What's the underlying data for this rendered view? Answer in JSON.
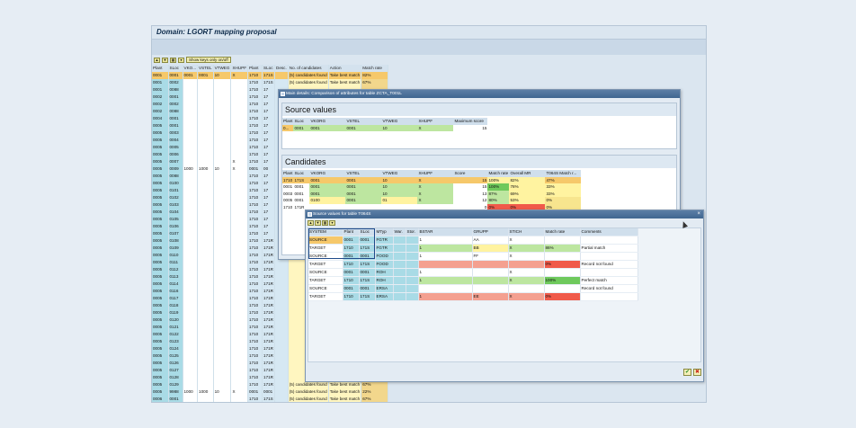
{
  "window_title": "Domain: LGORT mapping proposal",
  "toolbar": {
    "icon1": "filter-icon",
    "icon2": "sort-icon",
    "show_keys_label": "Show keys only on/off"
  },
  "grid": {
    "headers": [
      "Plant",
      "SLoc",
      "VKO...",
      "VSTEL",
      "VTWEG",
      "XHUPF",
      "Plant",
      "SLoc",
      "Desc.",
      "No. of candidates",
      "Action",
      "Match rate"
    ],
    "rows": [
      {
        "plant": "0001",
        "sloc": "0001",
        "vko": "0001",
        "vstel": "0001",
        "vtweg": "10",
        "xhupf": "X",
        "tplant": "1710",
        "tsloc": "171S",
        "cand": "(5) candidates found",
        "action": "Take best match",
        "rate": "82%"
      },
      {
        "plant": "0001",
        "sloc": "0002",
        "tplant": "1710",
        "tsloc": "171S",
        "cand": "(5) candidates found",
        "action": "Take best match",
        "rate": "67%"
      },
      {
        "plant": "0001",
        "sloc": "0088",
        "tplant": "1710",
        "tsloc": "17"
      },
      {
        "plant": "0002",
        "sloc": "0001",
        "tplant": "1710",
        "tsloc": "17"
      },
      {
        "plant": "0002",
        "sloc": "0002",
        "tplant": "1710",
        "tsloc": "17"
      },
      {
        "plant": "0002",
        "sloc": "0088",
        "tplant": "1710",
        "tsloc": "17"
      },
      {
        "plant": "0004",
        "sloc": "0001",
        "tplant": "1710",
        "tsloc": "17"
      },
      {
        "plant": "0005",
        "sloc": "0001",
        "tplant": "1710",
        "tsloc": "17"
      },
      {
        "plant": "0005",
        "sloc": "0003",
        "tplant": "1710",
        "tsloc": "17"
      },
      {
        "plant": "0005",
        "sloc": "0004",
        "tplant": "1710",
        "tsloc": "17"
      },
      {
        "plant": "0005",
        "sloc": "0005",
        "tplant": "1710",
        "tsloc": "17"
      },
      {
        "plant": "0005",
        "sloc": "0006",
        "tplant": "1710",
        "tsloc": "17"
      },
      {
        "plant": "0005",
        "sloc": "0007",
        "xhupf": "X",
        "tplant": "1710",
        "tsloc": "17"
      },
      {
        "plant": "0005",
        "sloc": "0009",
        "vko": "1000",
        "vstel": "1000",
        "vtweg": "10",
        "xhupf": "X",
        "tplant": "0001",
        "tsloc": "00"
      },
      {
        "plant": "0005",
        "sloc": "0088",
        "tplant": "1710",
        "tsloc": "17"
      },
      {
        "plant": "0005",
        "sloc": "0100",
        "tplant": "1710",
        "tsloc": "17"
      },
      {
        "plant": "0005",
        "sloc": "0101",
        "tplant": "1710",
        "tsloc": "17"
      },
      {
        "plant": "0005",
        "sloc": "0102",
        "tplant": "1710",
        "tsloc": "17"
      },
      {
        "plant": "0005",
        "sloc": "0103",
        "tplant": "1710",
        "tsloc": "17"
      },
      {
        "plant": "0005",
        "sloc": "0104",
        "tplant": "1710",
        "tsloc": "17"
      },
      {
        "plant": "0005",
        "sloc": "0105",
        "tplant": "1710",
        "tsloc": "17"
      },
      {
        "plant": "0005",
        "sloc": "0106",
        "tplant": "1710",
        "tsloc": "17"
      },
      {
        "plant": "0005",
        "sloc": "0107",
        "tplant": "1710",
        "tsloc": "17"
      },
      {
        "plant": "0005",
        "sloc": "0108",
        "tplant": "1710",
        "tsloc": "171R"
      },
      {
        "plant": "0005",
        "sloc": "0109",
        "tplant": "1710",
        "tsloc": "171R"
      },
      {
        "plant": "0005",
        "sloc": "0110",
        "tplant": "1710",
        "tsloc": "171R"
      },
      {
        "plant": "0005",
        "sloc": "0111",
        "tplant": "1710",
        "tsloc": "171R"
      },
      {
        "plant": "0005",
        "sloc": "0112",
        "tplant": "1710",
        "tsloc": "171R"
      },
      {
        "plant": "0005",
        "sloc": "0113",
        "tplant": "1710",
        "tsloc": "171R"
      },
      {
        "plant": "0005",
        "sloc": "0114",
        "tplant": "1710",
        "tsloc": "171R"
      },
      {
        "plant": "0005",
        "sloc": "0116",
        "tplant": "1710",
        "tsloc": "171R"
      },
      {
        "plant": "0005",
        "sloc": "0117",
        "tplant": "1710",
        "tsloc": "171R"
      },
      {
        "plant": "0005",
        "sloc": "0118",
        "tplant": "1710",
        "tsloc": "171R"
      },
      {
        "plant": "0005",
        "sloc": "0119",
        "tplant": "1710",
        "tsloc": "171R"
      },
      {
        "plant": "0005",
        "sloc": "0120",
        "tplant": "1710",
        "tsloc": "171R"
      },
      {
        "plant": "0005",
        "sloc": "0121",
        "tplant": "1710",
        "tsloc": "171R"
      },
      {
        "plant": "0005",
        "sloc": "0122",
        "tplant": "1710",
        "tsloc": "171R"
      },
      {
        "plant": "0005",
        "sloc": "0123",
        "tplant": "1710",
        "tsloc": "171R"
      },
      {
        "plant": "0005",
        "sloc": "0124",
        "tplant": "1710",
        "tsloc": "171R"
      },
      {
        "plant": "0005",
        "sloc": "0125",
        "tplant": "1710",
        "tsloc": "171R"
      },
      {
        "plant": "0005",
        "sloc": "0126",
        "tplant": "1710",
        "tsloc": "171R"
      },
      {
        "plant": "0005",
        "sloc": "0127",
        "tplant": "1710",
        "tsloc": "171R"
      },
      {
        "plant": "0005",
        "sloc": "0128",
        "tplant": "1710",
        "tsloc": "171R"
      },
      {
        "plant": "0005",
        "sloc": "0129",
        "tplant": "1710",
        "tsloc": "171R",
        "cand": "(5) candidates found",
        "action": "Take best match",
        "rate": "67%"
      },
      {
        "plant": "0005",
        "sloc": "9988",
        "vko": "1000",
        "vstel": "1000",
        "vtweg": "10",
        "xhupf": "X",
        "tplant": "0001",
        "tsloc": "0001",
        "cand": "(5) candidates found",
        "action": "Take best match",
        "rate": "22%"
      },
      {
        "plant": "0006",
        "sloc": "0001",
        "tplant": "1710",
        "tsloc": "171S",
        "cand": "(5) candidates found",
        "action": "Take best match",
        "rate": "67%"
      }
    ]
  },
  "main_details": {
    "title": "Main details: Comparison of attributes for table ZCTA_T001L",
    "source_values_title": "Source values",
    "source_headers": [
      "Plant",
      "SLoc",
      "VKORG",
      "VSTEL",
      "VTWEG",
      "XHUPF",
      "Maximum score"
    ],
    "source_row": [
      "0...",
      "0001",
      "0001",
      "0001",
      "10",
      "X",
      "15"
    ],
    "candidates_title": "Candidates",
    "cand_headers": [
      "Plant",
      "SLoc",
      "VKORG",
      "VSTEL",
      "VTWEG",
      "XHUPF",
      "Score",
      "Match rate",
      "Overall MR",
      "T064S Match r..."
    ],
    "cand_rows": [
      {
        "plant": "1710",
        "sloc": "171S",
        "vkorg": "0001",
        "vstel": "0001",
        "vtweg": "10",
        "xhupf": "X",
        "score": "15",
        "mr": "100%",
        "omr": "82%",
        "t064": "47%"
      },
      {
        "plant": "0001",
        "sloc": "0001",
        "vkorg": "0001",
        "vstel": "0001",
        "vtweg": "10",
        "xhupf": "X",
        "score": "15",
        "mr": "100%",
        "omr": "78%",
        "t064": "33%"
      },
      {
        "plant": "0003",
        "sloc": "0001",
        "vkorg": "0001",
        "vstel": "0001",
        "vtweg": "10",
        "xhupf": "X",
        "score": "13",
        "mr": "87%",
        "omr": "69%",
        "t064": "33%"
      },
      {
        "plant": "0005",
        "sloc": "0001",
        "vkorg": "0100",
        "vstel": "0001",
        "vtweg": "01",
        "xhupf": "X",
        "score": "12",
        "mr": "80%",
        "omr": "53%",
        "t064": "0%"
      },
      {
        "plant": "1710",
        "sloc": "171R",
        "vkorg": "",
        "vstel": "",
        "vtweg": "",
        "xhupf": "",
        "score": "0",
        "mr": "0%",
        "omr": "0%",
        "t064": "0%"
      }
    ]
  },
  "source_values_dialog": {
    "title": "Source values for table T064S",
    "headers": [
      "SYSTEM",
      "Plant",
      "SLoc",
      "MTyp",
      "War.",
      "Stor.",
      "BSTAR",
      "GRUPP",
      "STICH",
      "Match rate",
      "Comments"
    ],
    "rows": [
      {
        "system": "SOURCE",
        "plant": "0001",
        "sloc": "0001",
        "mtyp": "FGTR",
        "bstar": "1",
        "grupp": "AA",
        "stich": "X",
        "rate": "",
        "comment": ""
      },
      {
        "system": "TARGET",
        "plant": "1710",
        "sloc": "171S",
        "mtyp": "FGTR",
        "bstar": "1",
        "grupp": "BB",
        "stich": "X",
        "rate": "86%",
        "comment": "Partial match"
      },
      {
        "system": "SOURCE",
        "plant": "0001",
        "sloc": "0001",
        "mtyp": "FOOD",
        "bstar": "1",
        "grupp": "FF",
        "stich": "X",
        "rate": "",
        "comment": ""
      },
      {
        "system": "TARGET",
        "plant": "1710",
        "sloc": "171S",
        "mtyp": "FOOD",
        "bstar": "",
        "grupp": "",
        "stich": "",
        "rate": "0%",
        "comment": "Record not found"
      },
      {
        "system": "SOURCE",
        "plant": "0001",
        "sloc": "0001",
        "mtyp": "ROH",
        "bstar": "1",
        "grupp": "",
        "stich": "X",
        "rate": "",
        "comment": ""
      },
      {
        "system": "TARGET",
        "plant": "1710",
        "sloc": "171S",
        "mtyp": "ROH",
        "bstar": "1",
        "grupp": "",
        "stich": "X",
        "rate": "100%",
        "comment": "Perfect match"
      },
      {
        "system": "SOURCE",
        "plant": "0001",
        "sloc": "0001",
        "mtyp": "ERSA",
        "bstar": "",
        "grupp": "",
        "stich": "",
        "rate": "",
        "comment": "Record not found"
      },
      {
        "system": "TARGET",
        "plant": "1710",
        "sloc": "171S",
        "mtyp": "ERSA",
        "bstar": "1",
        "grupp": "EE",
        "stich": "X",
        "rate": "0%",
        "comment": ""
      }
    ],
    "ok_icon": "check-icon",
    "cancel_icon": "cancel-icon"
  }
}
